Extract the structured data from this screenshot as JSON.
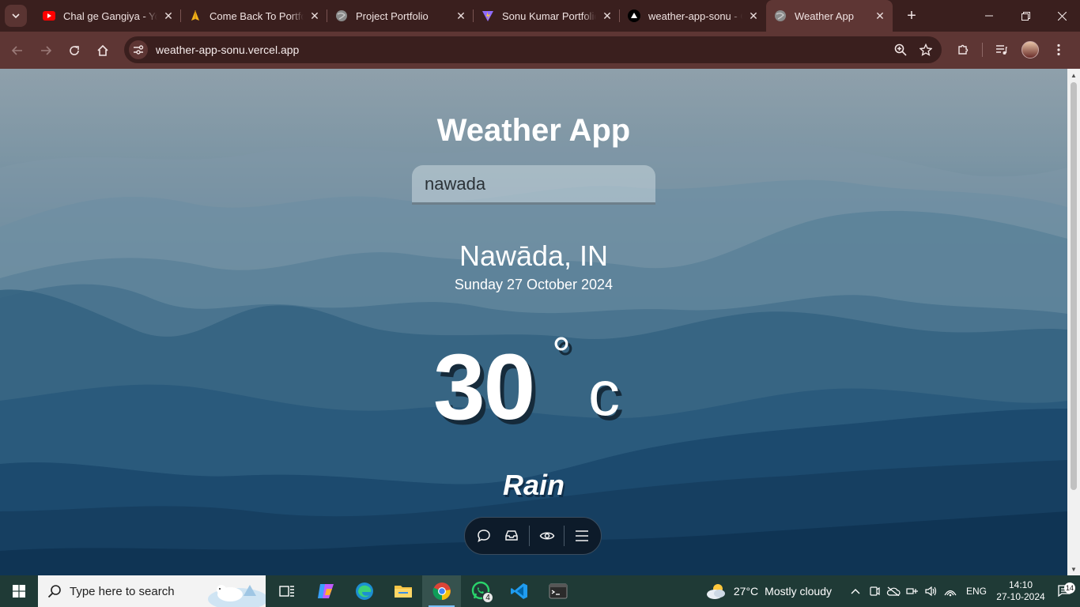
{
  "browser": {
    "tabs": [
      {
        "title": "Chal ge Gangiya - You",
        "icon": "youtube-icon"
      },
      {
        "title": "Come Back To Portfol",
        "icon": "folded-hands-icon"
      },
      {
        "title": "Project Portfolio",
        "icon": "globe-icon"
      },
      {
        "title": "Sonu Kumar Portfolio",
        "icon": "vite-icon"
      },
      {
        "title": "weather-app-sonu - C",
        "icon": "vercel-icon"
      },
      {
        "title": "Weather App",
        "icon": "globe-icon",
        "active": true
      }
    ],
    "url": "weather-app-sonu.vercel.app",
    "accent": "#5e3634",
    "frame": "#3a1f1e"
  },
  "app": {
    "title": "Weather App",
    "search_value": "nawada",
    "location": "Nawāda, IN",
    "date": "Sunday 27 October 2024",
    "temperature": "30",
    "degree_symbol": "°",
    "unit": "c",
    "condition": "Rain"
  },
  "taskbar": {
    "search_placeholder": "Type here to search",
    "whatsapp_badge": "4",
    "weather_temp": "27°C",
    "weather_desc": "Mostly cloudy",
    "language": "ENG",
    "time": "14:10",
    "date": "27-10-2024",
    "notification_count": "14"
  }
}
